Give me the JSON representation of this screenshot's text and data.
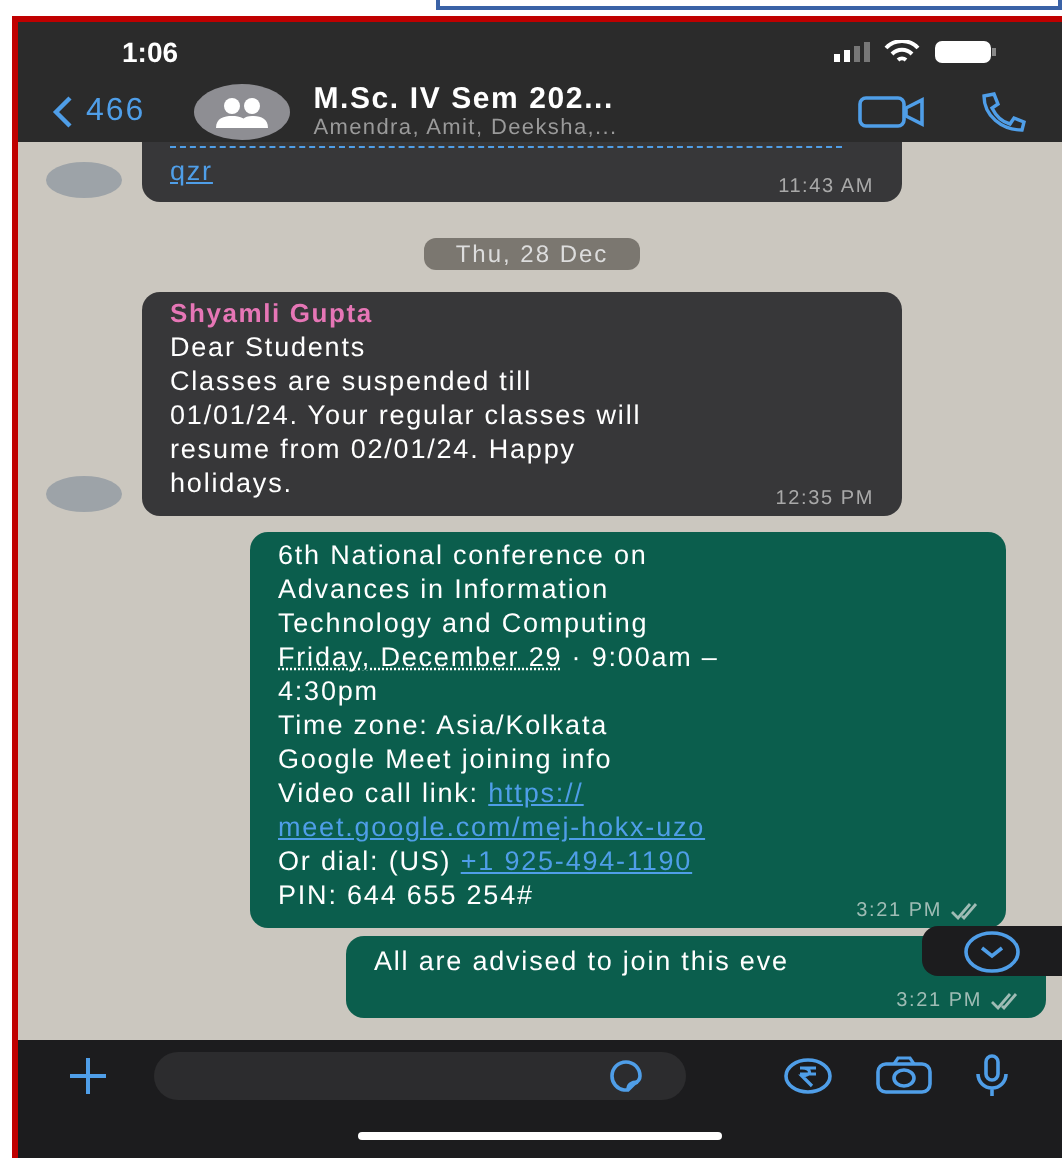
{
  "status_bar": {
    "time": "1:06"
  },
  "header": {
    "back_count": "466",
    "title": "M.Sc. IV Sem 202...",
    "subtitle": "Amendra, Amit, Deeksha,..."
  },
  "messages": [
    {
      "kind": "incoming",
      "lines": [
        [
          {
            "text": "qzr",
            "kind": "link"
          }
        ]
      ],
      "time": "11:43 AM"
    },
    {
      "kind": "date",
      "text": "Thu, 28 Dec"
    },
    {
      "kind": "incoming",
      "sender": "Shyamli Gupta",
      "color": "#e676b6",
      "lines": [
        [
          "Dear Students"
        ],
        [
          "Classes are suspended till"
        ],
        [
          "01/01/24. Your regular classes will"
        ],
        [
          "resume from 02/01/24. Happy"
        ],
        [
          "holidays."
        ]
      ],
      "time": "12:35 PM"
    },
    {
      "kind": "outgoing",
      "read": false,
      "lines": [
        [
          "6th National conference on"
        ],
        [
          "Advances in Information"
        ],
        [
          "Technology  and Computing"
        ],
        [
          {
            "text": "Friday, December 29",
            "kind": "date_link"
          },
          " · 9:00am –"
        ],
        [
          "4:30pm"
        ],
        [
          "Time zone: Asia/Kolkata"
        ],
        [
          "Google Meet joining info"
        ],
        [
          "Video call link: ",
          {
            "text": "https://",
            "kind": "link"
          }
        ],
        [
          {
            "text": "meet.google.com/mej-hokx-uzo",
            "kind": "link"
          }
        ],
        [
          "Or dial: (US) ",
          {
            "text": "+1 925-494-1190",
            "kind": "link"
          }
        ],
        [
          "PIN: 644 655 254#"
        ]
      ],
      "time": "3:21 PM"
    },
    {
      "kind": "outgoing",
      "read": false,
      "lines": [
        [
          "All are advised to join this eve"
        ]
      ],
      "time": "3:21 PM"
    }
  ]
}
